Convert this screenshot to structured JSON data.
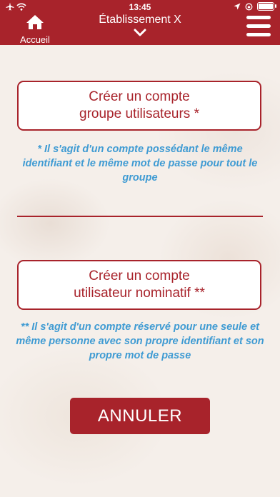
{
  "status_bar": {
    "time": "13:45"
  },
  "header": {
    "home_label": "Accueil",
    "title": "Établissement X"
  },
  "group_account": {
    "line1": "Créer un compte",
    "line2": "groupe utilisateurs *",
    "note": "* Il s'agit d'un compte possédant le même identifiant et le même mot de passe pour tout le groupe"
  },
  "nominative_account": {
    "line1": "Créer un compte",
    "line2": "utilisateur nominatif **",
    "note": "** Il s'agit d'un compte réservé pour une seule et même personne avec son propre identifiant et son propre mot de passe"
  },
  "cancel_label": "ANNULER",
  "colors": {
    "brand": "#a8232b",
    "note": "#3f9bd3"
  }
}
